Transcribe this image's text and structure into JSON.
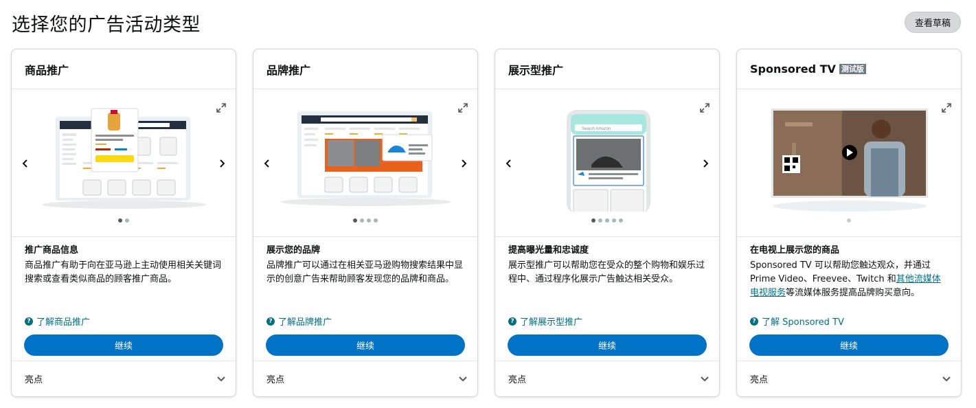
{
  "page": {
    "title": "选择您的广告活动类型",
    "draft_button": "查看草稿"
  },
  "cards": [
    {
      "title": "商品推广",
      "badge": "",
      "subtitle": "推广商品信息",
      "desc": "商品推广有助于向在亚马逊上主动使用相关关键词搜索或查看类似商品的顾客推广商品。",
      "learn": "了解商品推广",
      "continue": "继续",
      "highlights": "亮点",
      "slides": 2,
      "active_slide": 1,
      "illustration": "laptop-product-listing"
    },
    {
      "title": "品牌推广",
      "badge": "",
      "subtitle": "展示您的品牌",
      "desc": "品牌推广可以通过在相关亚马逊购物搜索结果中显示的创意广告来帮助顾客发现您的品牌和商品。",
      "learn": "了解品牌推广",
      "continue": "继续",
      "highlights": "亮点",
      "slides": 4,
      "active_slide": 1,
      "illustration": "laptop-brand-banner"
    },
    {
      "title": "展示型推广",
      "badge": "",
      "subtitle": "提高曝光量和忠诚度",
      "desc": "展示型推广可以帮助您在受众的整个购物和娱乐过程中、通过程序化展示广告触达相关受众。",
      "learn": "了解展示型推广",
      "continue": "继续",
      "highlights": "亮点",
      "slides": 5,
      "active_slide": 1,
      "illustration": "phone-display-ad",
      "search_placeholder": "Search Amazon"
    },
    {
      "title": "Sponsored TV",
      "badge": "测试版",
      "subtitle": "在电视上展示您的商品",
      "desc_before": "Sponsored TV 可以帮助您触达观众，并通过 Prime Video、Freevee、Twitch 和",
      "desc_link": "其他流媒体电视服务",
      "desc_after": "等流媒体服务提高品牌购买意向。",
      "learn": "了解 Sponsored TV",
      "continue": "继续",
      "highlights": "亮点",
      "slides": 1,
      "active_slide": 1,
      "illustration": "tv-video-ad"
    }
  ],
  "icons": {
    "expand": "expand-icon",
    "prev": "chevron-left-icon",
    "next": "chevron-right-icon",
    "help": "question-circle-icon",
    "collapse": "chevron-down-icon"
  },
  "colors": {
    "primary_button": "#0073c7",
    "link": "#007185",
    "accent_orange": "#e8611d"
  }
}
